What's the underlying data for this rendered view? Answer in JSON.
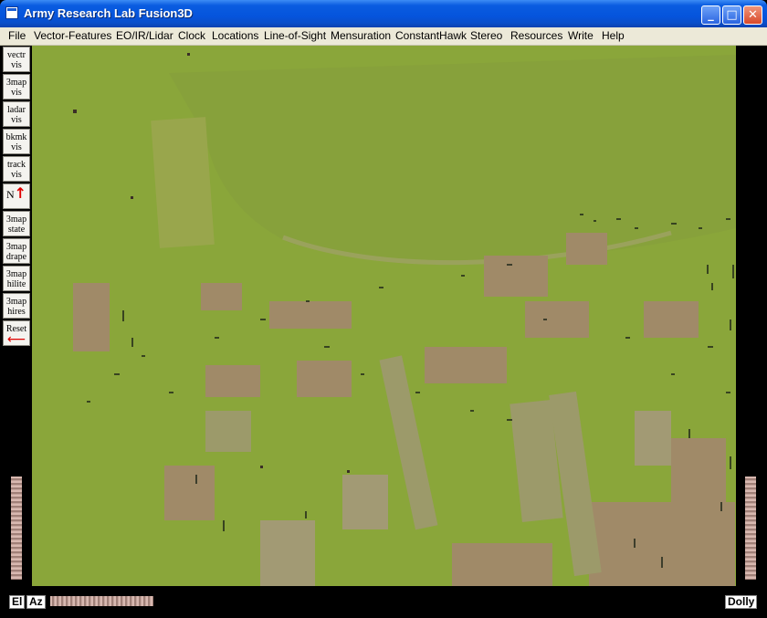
{
  "window": {
    "title": "Army Research Lab Fusion3D"
  },
  "menu": [
    "File",
    "Vector-Features",
    "EO/IR/Lidar",
    "Clock",
    "Locations",
    "Line-of-Sight",
    "Mensuration",
    "ConstantHawk",
    "Stereo",
    "Resources",
    "Write",
    "Help"
  ],
  "toolbar": {
    "vectr": [
      "vectr",
      "vis"
    ],
    "map3": [
      "3map",
      "vis"
    ],
    "ladar": [
      "ladar",
      "vis"
    ],
    "bkmk": [
      "bkmk",
      "vis"
    ],
    "track": [
      "track",
      "vis"
    ],
    "north": "N",
    "state": [
      "3map",
      "state"
    ],
    "drape": [
      "3map",
      "drape"
    ],
    "hilite": [
      "3map",
      "hilite"
    ],
    "hires": [
      "3map",
      "hires"
    ],
    "reset": "Reset"
  },
  "bottom": {
    "el": "El",
    "az": "Az",
    "dolly": "Dolly"
  },
  "colors": {
    "terrain": "#8aa63a",
    "buildings": "#a08a68",
    "title_bar": "#0554dc",
    "menu_bg": "#ece9d8"
  }
}
